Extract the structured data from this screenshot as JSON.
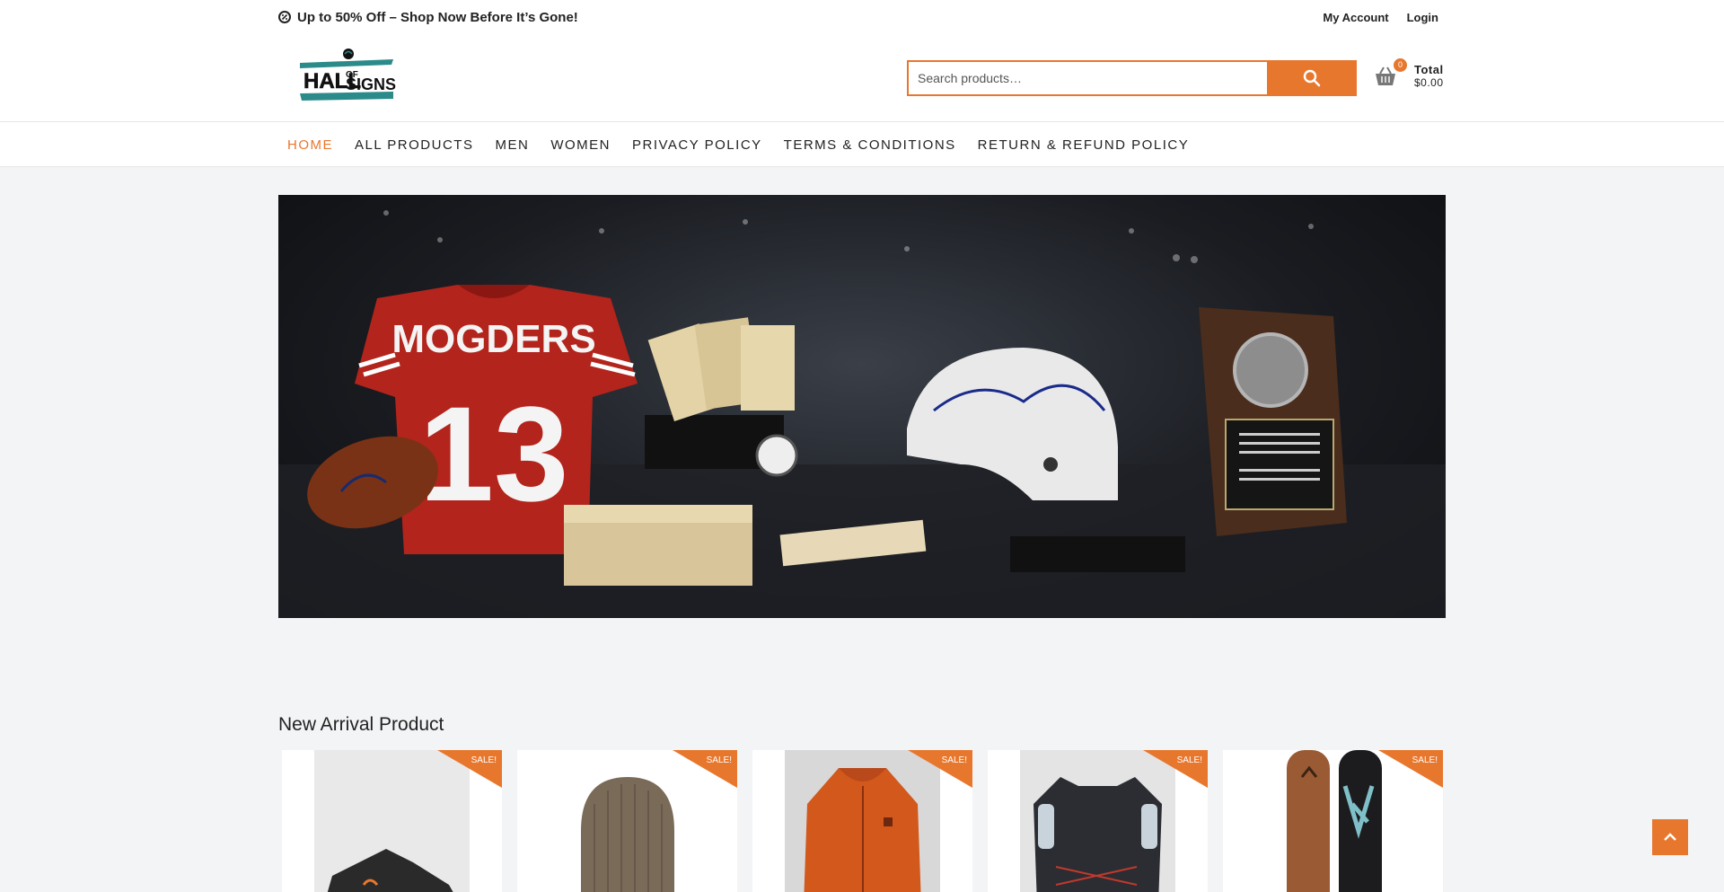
{
  "topbar": {
    "promo_text": "Up to 50% Off – Shop Now Before It’s Gone!",
    "my_account": "My Account",
    "login": "Login"
  },
  "header": {
    "logo_text_top": "HALL",
    "logo_text_mid": "OF",
    "logo_text_bottom": "SIGNS",
    "search_placeholder": "Search products…",
    "cart_count": "0",
    "cart_total_label": "Total",
    "cart_total_value": "$0.00"
  },
  "nav": {
    "items": [
      {
        "label": "HOME",
        "active": true
      },
      {
        "label": "ALL PRODUCTS"
      },
      {
        "label": "MEN"
      },
      {
        "label": "WOMEN"
      },
      {
        "label": "PRIVACY POLICY"
      },
      {
        "label": "TERMS & CONDITIONS"
      },
      {
        "label": "RETURN & REFUND POLICY"
      }
    ]
  },
  "hero": {
    "jersey_name": "MOGDERS",
    "jersey_number": "13"
  },
  "section": {
    "title": "New Arrival Product"
  },
  "products": [
    {
      "badge": "SALE!",
      "image": "hiking-shoe"
    },
    {
      "badge": "SALE!",
      "image": "beanie"
    },
    {
      "badge": "SALE!",
      "image": "orange-jacket"
    },
    {
      "badge": "SALE!",
      "image": "running-vest"
    },
    {
      "badge": "SALE!",
      "image": "snowboards"
    }
  ],
  "colors": {
    "accent": "#e8772e",
    "text": "#222222",
    "page_bg": "#f3f4f6"
  }
}
